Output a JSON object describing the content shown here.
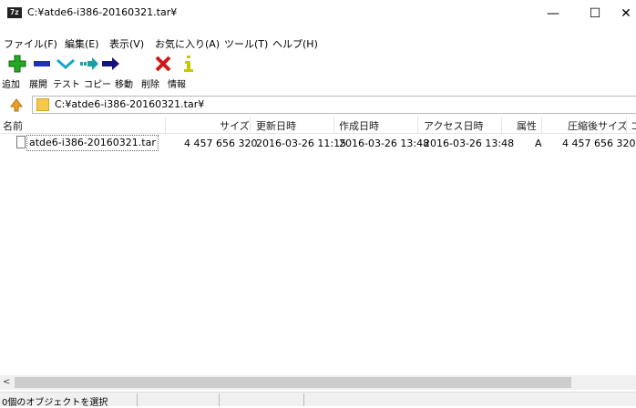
{
  "window": {
    "app_icon_text": "7z",
    "title": "C:¥atde6-i386-20160321.tar¥",
    "minimize_glyph": "—",
    "maximize_glyph": "☐",
    "close_glyph": "✕"
  },
  "menu": [
    "ファイル(F)",
    "編集(E)",
    "表示(V)",
    "お気に入り(A)",
    "ツール(T)",
    "ヘルプ(H)"
  ],
  "toolbar": {
    "items": [
      {
        "label": "追加",
        "icon": "add-icon",
        "color": "#22aa22"
      },
      {
        "label": "展開",
        "icon": "extract-icon",
        "color": "#1f2fbf"
      },
      {
        "label": "テスト",
        "icon": "test-icon",
        "color": "#18a7c9"
      },
      {
        "label": "コピー",
        "icon": "copy-icon",
        "color": "#1aa0a0"
      },
      {
        "label": "移動",
        "icon": "move-icon",
        "color": "#14147a"
      },
      {
        "label": "削除",
        "icon": "delete-icon",
        "color": "#d01818"
      },
      {
        "label": "情報",
        "icon": "info-icon",
        "color": "#c8c800"
      }
    ]
  },
  "address": {
    "path": "C:¥atde6-i386-20160321.tar¥"
  },
  "columns": [
    "名前",
    "サイズ",
    "更新日時",
    "作成日時",
    "アクセス日時",
    "属性",
    "圧縮後サイズ",
    "コ"
  ],
  "files": [
    {
      "name": "atde6-i386-20160321.tar",
      "size": "4 457 656 320",
      "modified": "2016-03-26 11:15",
      "created": "2016-03-26 13:48",
      "accessed": "2016-03-26 13:48",
      "attributes": "A",
      "packed_size": "4 457 656 320"
    }
  ],
  "status": {
    "selection": "0個のオブジェクトを選択"
  },
  "scrollbar": {
    "left_arrow": "<"
  }
}
